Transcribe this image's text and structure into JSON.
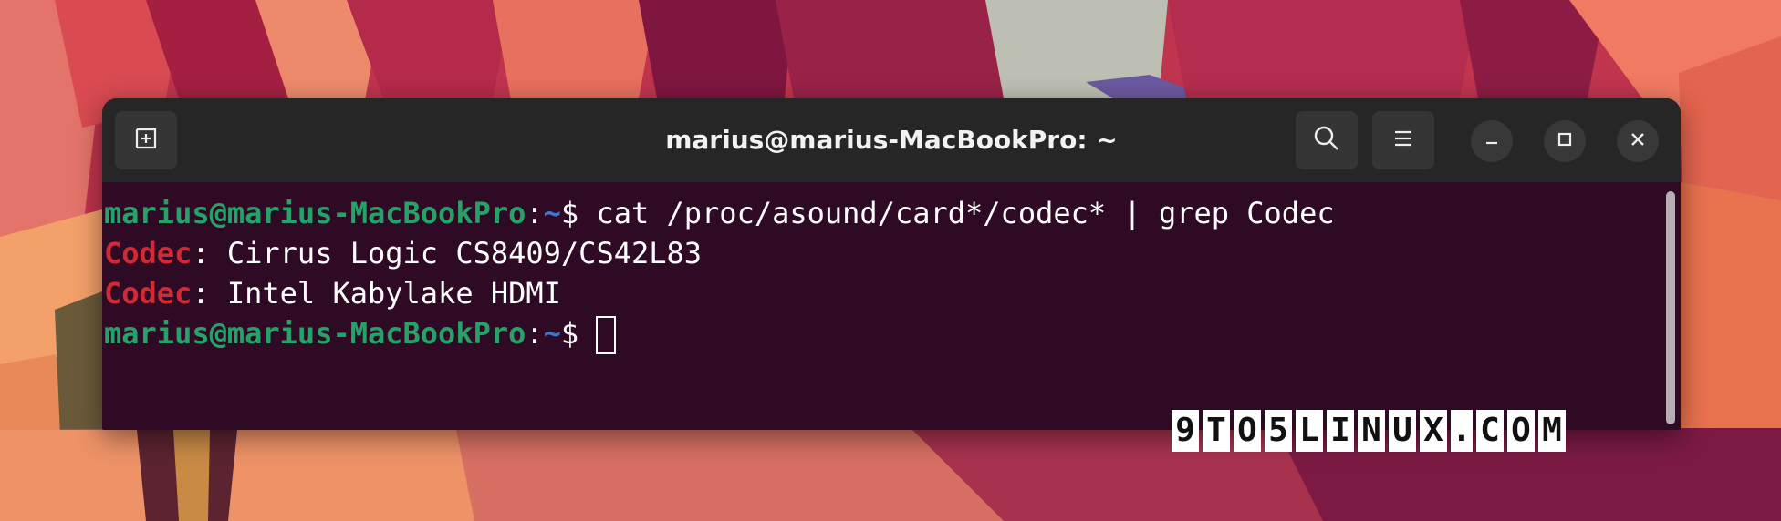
{
  "window": {
    "title": "marius@marius-MacBookPro: ~"
  },
  "titlebar_buttons": {
    "new_tab_icon": "new-tab-icon",
    "search_icon": "search-icon",
    "menu_icon": "hamburger-menu-icon",
    "minimize_icon": "minimize-icon",
    "maximize_icon": "maximize-icon",
    "close_icon": "close-icon"
  },
  "terminal": {
    "line1": {
      "user_host": "marius@marius-MacBookPro",
      "sep": ":",
      "path": "~",
      "dollar": "$ ",
      "command": "cat /proc/asound/card*/codec* | grep Codec"
    },
    "line2": {
      "key": "Codec",
      "rest": ": Cirrus Logic CS8409/CS42L83"
    },
    "line3": {
      "key": "Codec",
      "rest": ": Intel Kabylake HDMI"
    },
    "line4": {
      "user_host": "marius@marius-MacBookPro",
      "sep": ":",
      "path": "~",
      "dollar": "$ "
    }
  },
  "watermark": {
    "chars": [
      "9",
      "T",
      "O",
      "5",
      "L",
      "I",
      "N",
      "U",
      "X",
      ".",
      "C",
      "O",
      "M"
    ]
  },
  "colors": {
    "terminal_bg": "#2e0a25",
    "titlebar_bg": "#262626",
    "prompt_green": "#26a269",
    "path_blue": "#3f76c8",
    "codec_red": "#d02a36"
  }
}
